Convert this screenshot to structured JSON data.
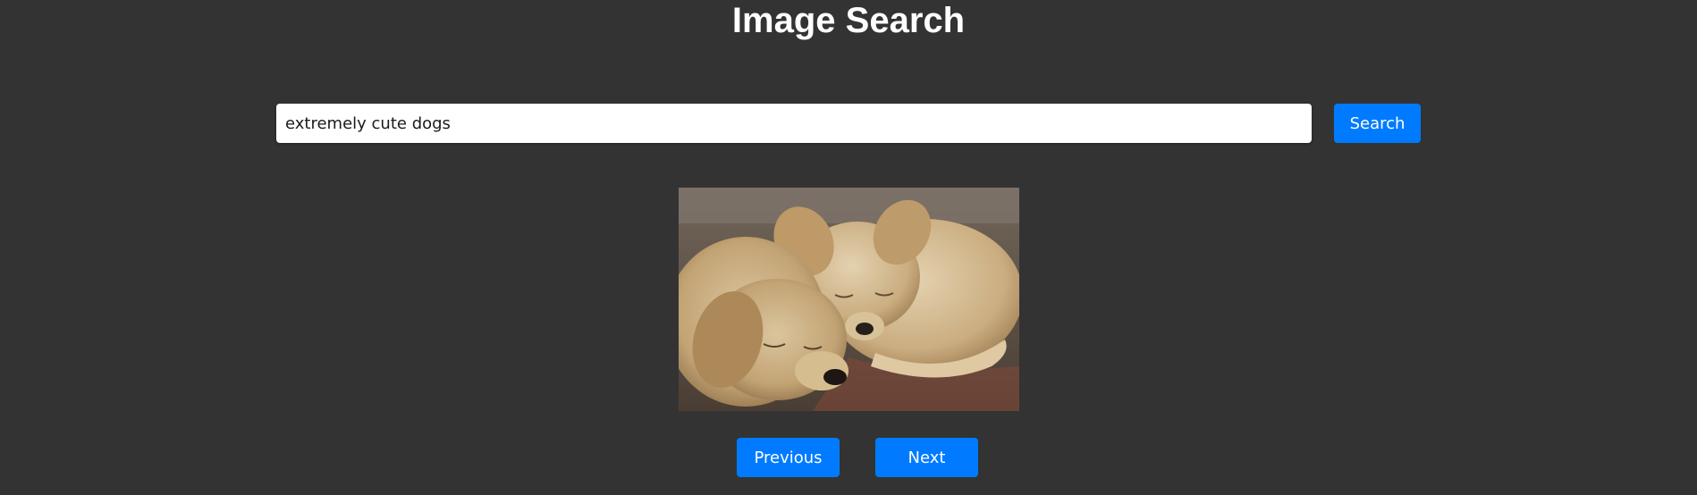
{
  "header": {
    "title": "Image Search"
  },
  "search": {
    "query": "extremely cute dogs",
    "button_label": "Search"
  },
  "result": {
    "image_subject": "two sleeping golden retriever puppies"
  },
  "pagination": {
    "previous_label": "Previous",
    "next_label": "Next"
  },
  "colors": {
    "background": "#333333",
    "accent": "#007bff",
    "title_text": "#ffffff"
  }
}
